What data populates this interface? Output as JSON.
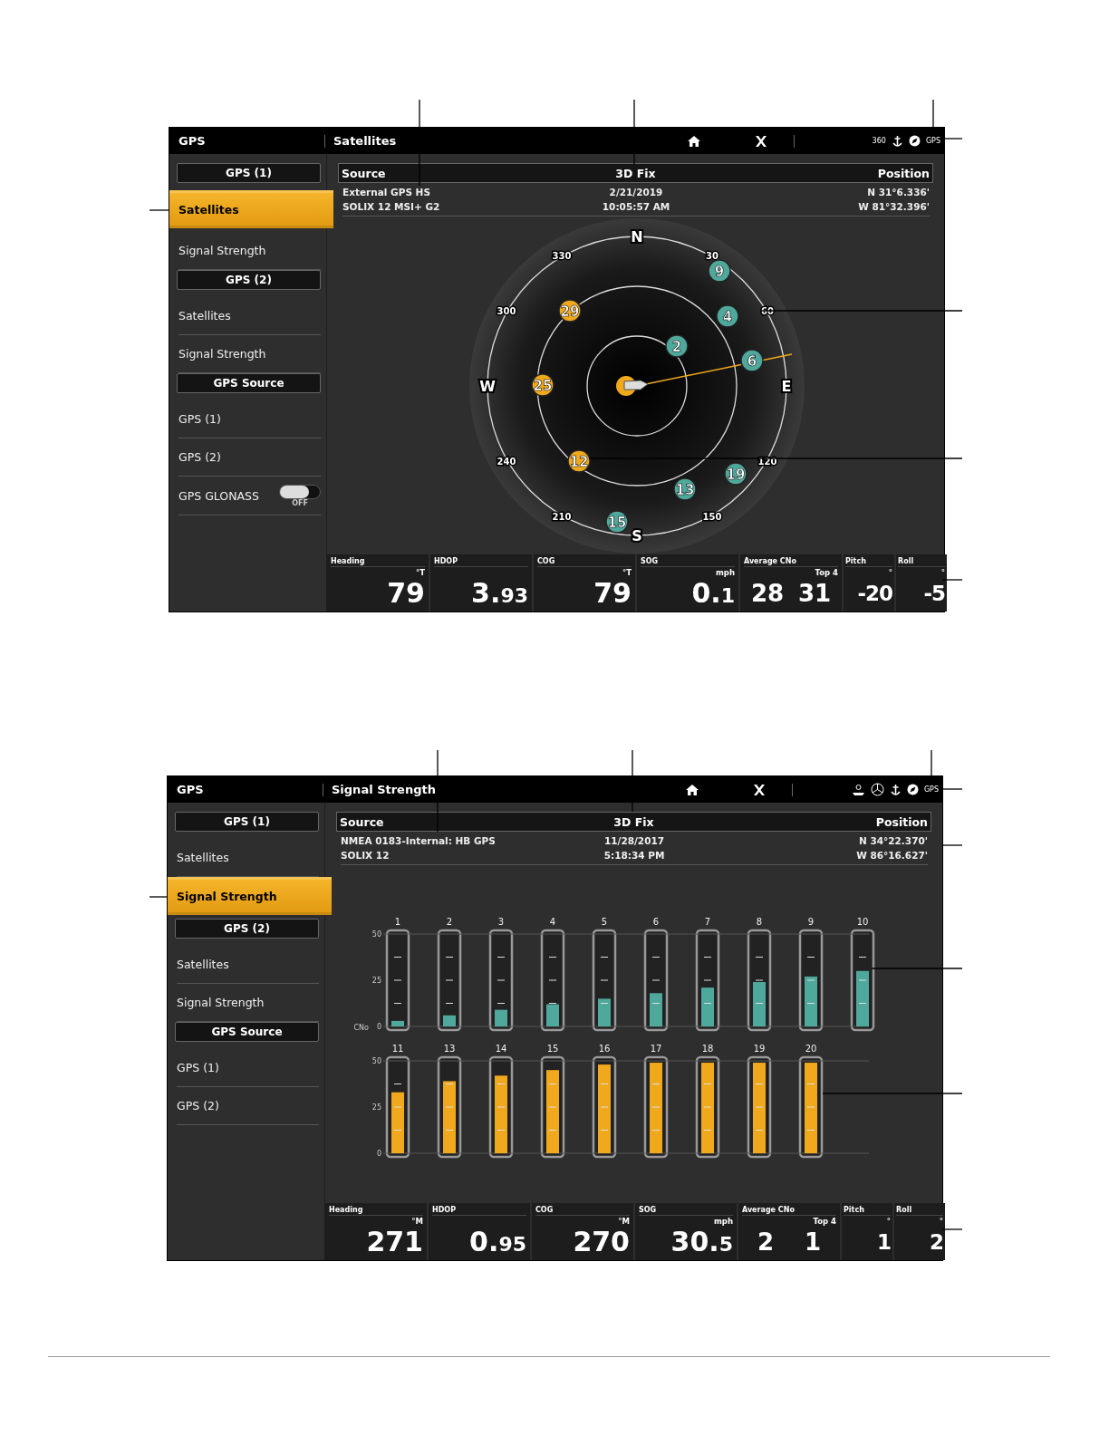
{
  "screens": [
    {
      "app_title": "GPS",
      "page_title": "Satellites",
      "status_icons": [
        {
          "kind": "text",
          "label": "360"
        },
        {
          "kind": "anchor"
        },
        {
          "kind": "compass"
        },
        {
          "kind": "text",
          "label": "GPS"
        }
      ],
      "nav": [
        {
          "kind": "header",
          "label": "GPS (1)",
          "selected": false
        },
        {
          "kind": "item",
          "label": "Satellites",
          "selected": true
        },
        {
          "kind": "item",
          "label": "Signal Strength",
          "selected": false
        },
        {
          "kind": "header",
          "label": "GPS (2)",
          "selected": false
        },
        {
          "kind": "item",
          "label": "Satellites",
          "selected": false
        },
        {
          "kind": "item",
          "label": "Signal Strength",
          "selected": false
        },
        {
          "kind": "header",
          "label": "GPS Source",
          "selected": false
        },
        {
          "kind": "item",
          "label": "GPS (1)",
          "selected": false
        },
        {
          "kind": "item",
          "label": "GPS (2)",
          "selected": false
        },
        {
          "kind": "toggle",
          "label": "GPS GLONASS",
          "selected": false,
          "on": false,
          "state_label": "OFF"
        }
      ],
      "info": {
        "headers": [
          "Source",
          "3D Fix",
          "Position"
        ],
        "rows": [
          [
            "External GPS HS",
            "2/21/2019",
            "N 31°6.336'"
          ],
          [
            "SOLIX 12 MSI+ G2",
            "10:05:57 AM",
            "W 81°32.396'"
          ]
        ]
      },
      "content": {
        "kind": "skyview",
        "cardinals": [
          "N",
          "E",
          "S",
          "W"
        ],
        "bearings": [
          "330",
          "30",
          "300",
          "60",
          "240",
          "120",
          "210",
          "150"
        ],
        "satellites": [
          {
            "number": "9",
            "color": "#4fa89c"
          },
          {
            "number": "4",
            "color": "#4fa89c"
          },
          {
            "number": "29",
            "color": "#f0a81c"
          },
          {
            "number": "2",
            "color": "#4fa89c"
          },
          {
            "number": "6",
            "color": "#4fa89c"
          },
          {
            "number": "25",
            "color": "#f0a81c"
          },
          {
            "number": "12",
            "color": "#f0a81c"
          },
          {
            "number": "19",
            "color": "#4fa89c"
          },
          {
            "number": "13",
            "color": "#4fa89c"
          },
          {
            "number": "15",
            "color": "#4fa89c"
          }
        ]
      },
      "gauges": [
        {
          "label": "Heading",
          "unit": "°T",
          "values": [
            "79"
          ]
        },
        {
          "label": "HDOP",
          "values": [
            "3.",
            "93"
          ],
          "kind": "split"
        },
        {
          "label": "COG",
          "unit": "°T",
          "values": [
            "79"
          ]
        },
        {
          "label": "SOG",
          "unit": "mph",
          "values": [
            "0.",
            "1"
          ],
          "kind": "split"
        },
        {
          "label": "Average CNo",
          "unit": "Top 4",
          "values": [
            "28",
            "31"
          ],
          "kind": "pair"
        },
        {
          "label": "Pitch",
          "unit": "°",
          "values": [
            "-20"
          ],
          "kind": "narrow"
        },
        {
          "label": "Roll",
          "unit": "°",
          "values": [
            "-5"
          ],
          "kind": "narrow"
        }
      ]
    },
    {
      "app_title": "GPS",
      "page_title": "Signal Strength",
      "status_icons": [
        {
          "kind": "boat"
        },
        {
          "kind": "wheel"
        },
        {
          "kind": "anchor"
        },
        {
          "kind": "compass"
        },
        {
          "kind": "text",
          "label": "GPS"
        }
      ],
      "nav": [
        {
          "kind": "header",
          "label": "GPS (1)",
          "selected": false
        },
        {
          "kind": "item",
          "label": "Satellites",
          "selected": false
        },
        {
          "kind": "item",
          "label": "Signal Strength",
          "selected": true
        },
        {
          "kind": "header",
          "label": "GPS (2)",
          "selected": false
        },
        {
          "kind": "item",
          "label": "Satellites",
          "selected": false
        },
        {
          "kind": "item",
          "label": "Signal Strength",
          "selected": false
        },
        {
          "kind": "header",
          "label": "GPS Source",
          "selected": false
        },
        {
          "kind": "item",
          "label": "GPS (1)",
          "selected": false
        },
        {
          "kind": "item",
          "label": "GPS (2)",
          "selected": false
        }
      ],
      "info": {
        "headers": [
          "Source",
          "3D Fix",
          "Position"
        ],
        "rows": [
          [
            "NMEA 0183-Internal: HB GPS",
            "11/28/2017",
            "N 34°22.370'"
          ],
          [
            "SOLIX 12",
            "5:18:34 PM",
            "W 86°16.627'"
          ]
        ]
      },
      "content": {
        "kind": "bars",
        "charts": [
          {
            "chart_data": {
              "type": "bar",
              "ylabel": "CNo",
              "categories": [
                "1",
                "2",
                "3",
                "4",
                "5",
                "6",
                "7",
                "8",
                "9",
                "10"
              ],
              "ylim": [
                0,
                50
              ],
              "yticks": [
                0,
                25,
                50
              ],
              "series": [
                {
                  "color": "#4fa89c",
                  "values": [
                    3,
                    6,
                    9,
                    12,
                    15,
                    18,
                    21,
                    24,
                    27,
                    30
                  ]
                }
              ]
            }
          },
          {
            "chart_data": {
              "type": "bar",
              "categories": [
                "11",
                "13",
                "14",
                "15",
                "16",
                "17",
                "18",
                "19",
                "20"
              ],
              "ylim": [
                0,
                50
              ],
              "yticks": [
                0,
                25,
                50
              ],
              "series": [
                {
                  "color": "#f0a81c",
                  "values": [
                    33,
                    39,
                    42,
                    45,
                    48,
                    49,
                    49,
                    49,
                    49
                  ]
                }
              ]
            }
          }
        ]
      },
      "gauges": [
        {
          "label": "Heading",
          "unit": "°M",
          "values": [
            "271"
          ]
        },
        {
          "label": "HDOP",
          "values": [
            "0.",
            "95"
          ],
          "kind": "split"
        },
        {
          "label": "COG",
          "unit": "°M",
          "values": [
            "270"
          ]
        },
        {
          "label": "SOG",
          "unit": "mph",
          "values": [
            "30.",
            "5"
          ],
          "kind": "split"
        },
        {
          "label": "Average CNo",
          "unit": "Top 4",
          "values": [
            "2",
            "1"
          ],
          "kind": "pair"
        },
        {
          "label": "Pitch",
          "unit": "°",
          "values": [
            "1"
          ],
          "kind": "narrow"
        },
        {
          "label": "Roll",
          "unit": "°",
          "values": [
            "2"
          ],
          "kind": "narrow"
        }
      ]
    }
  ]
}
